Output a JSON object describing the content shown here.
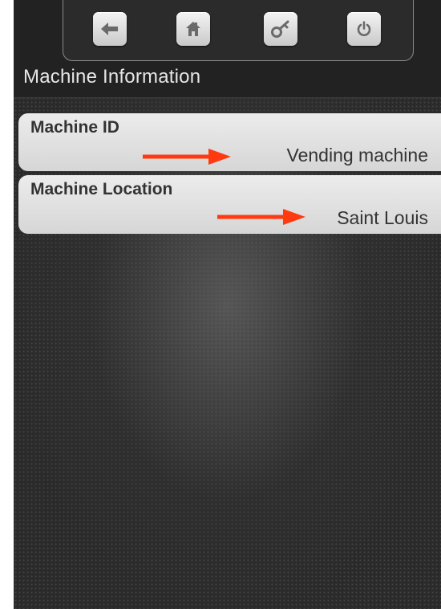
{
  "header": {
    "title": "Machine Information",
    "buttons": [
      {
        "name": "back-button",
        "icon": "arrow-left-icon"
      },
      {
        "name": "home-button",
        "icon": "home-icon"
      },
      {
        "name": "key-button",
        "icon": "key-icon"
      },
      {
        "name": "power-button",
        "icon": "power-icon"
      }
    ]
  },
  "fields": [
    {
      "label": "Machine ID",
      "value": "Vending machine"
    },
    {
      "label": "Machine Location",
      "value": "Saint Louis"
    }
  ],
  "colors": {
    "annotation_arrow": "#ff3a10",
    "screen_background": "#2a2a2a",
    "card_background": "#e4e4e4",
    "title_text": "#e6e6e6"
  }
}
